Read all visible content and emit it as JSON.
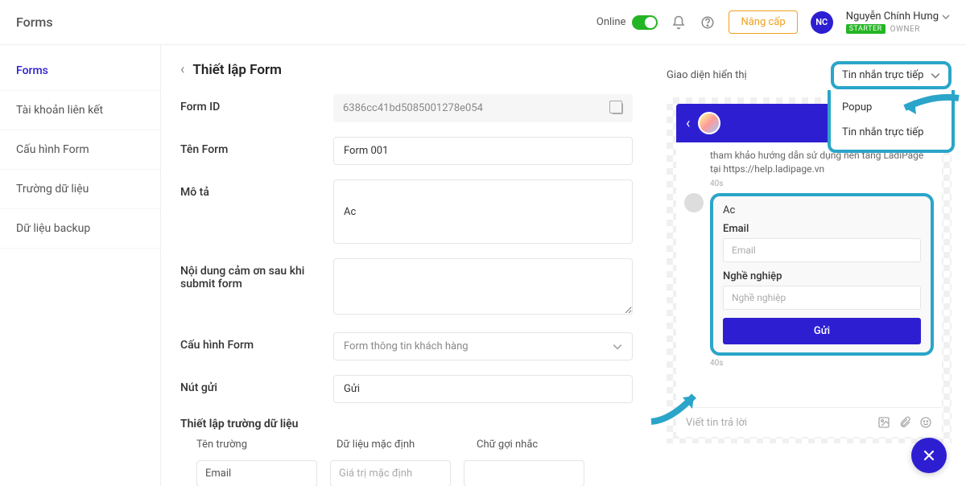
{
  "header": {
    "title": "Forms",
    "online_label": "Online",
    "upgrade_label": "Nâng cấp",
    "avatar_initials": "NC",
    "user_name": "Nguyễn Chính Hưng",
    "badge_starter": "STARTER",
    "owner_label": "OWNER"
  },
  "sidebar": {
    "items": [
      {
        "label": "Forms",
        "active": true
      },
      {
        "label": "Tài khoản liên kết",
        "active": false
      },
      {
        "label": "Cấu hình Form",
        "active": false
      },
      {
        "label": "Trường dữ liệu",
        "active": false
      },
      {
        "label": "Dữ liệu backup",
        "active": false
      }
    ]
  },
  "main": {
    "page_title": "Thiết lập Form",
    "labels": {
      "form_id": "Form ID",
      "form_name": "Tên Form",
      "description": "Mô tả",
      "thankyou": "Nội dung cảm ơn sau khi submit form",
      "form_config": "Cấu hình Form",
      "submit_button": "Nút gửi",
      "field_setup": "Thiết lập trường dữ liệu"
    },
    "values": {
      "form_id": "6386cc41bd5085001278e054",
      "form_name": "Form 001",
      "description": "Ac",
      "thankyou": "",
      "form_config_placeholder": "Form thông tin khách hàng",
      "submit_button": "Gửi"
    },
    "field_columns": {
      "name": "Tên trường",
      "default": "Dữ liệu mặc định",
      "hint": "Chữ gợi nhắc"
    },
    "field_row": {
      "name": "Email",
      "default_placeholder": "Giá trị mặc định",
      "hint": ""
    }
  },
  "preview": {
    "display_label": "Giao diện hiển thị",
    "display_selected": "Tin nhắn trực tiếp",
    "dropdown": [
      "Popup",
      "Tin nhắn trực tiếp"
    ],
    "chat": {
      "intro_line": "tham khảo hướng dẫn sử dụng nền tảng LadiPage tại https://help.ladipage.vn",
      "time1": "40s",
      "form_title": "Ac",
      "field1_label": "Email",
      "field1_placeholder": "Email",
      "field2_label": "Nghề nghiệp",
      "field2_placeholder": "Nghề nghiệp",
      "submit_label": "Gửi",
      "time2": "40s",
      "reply_placeholder": "Viết tin trả lời"
    }
  }
}
